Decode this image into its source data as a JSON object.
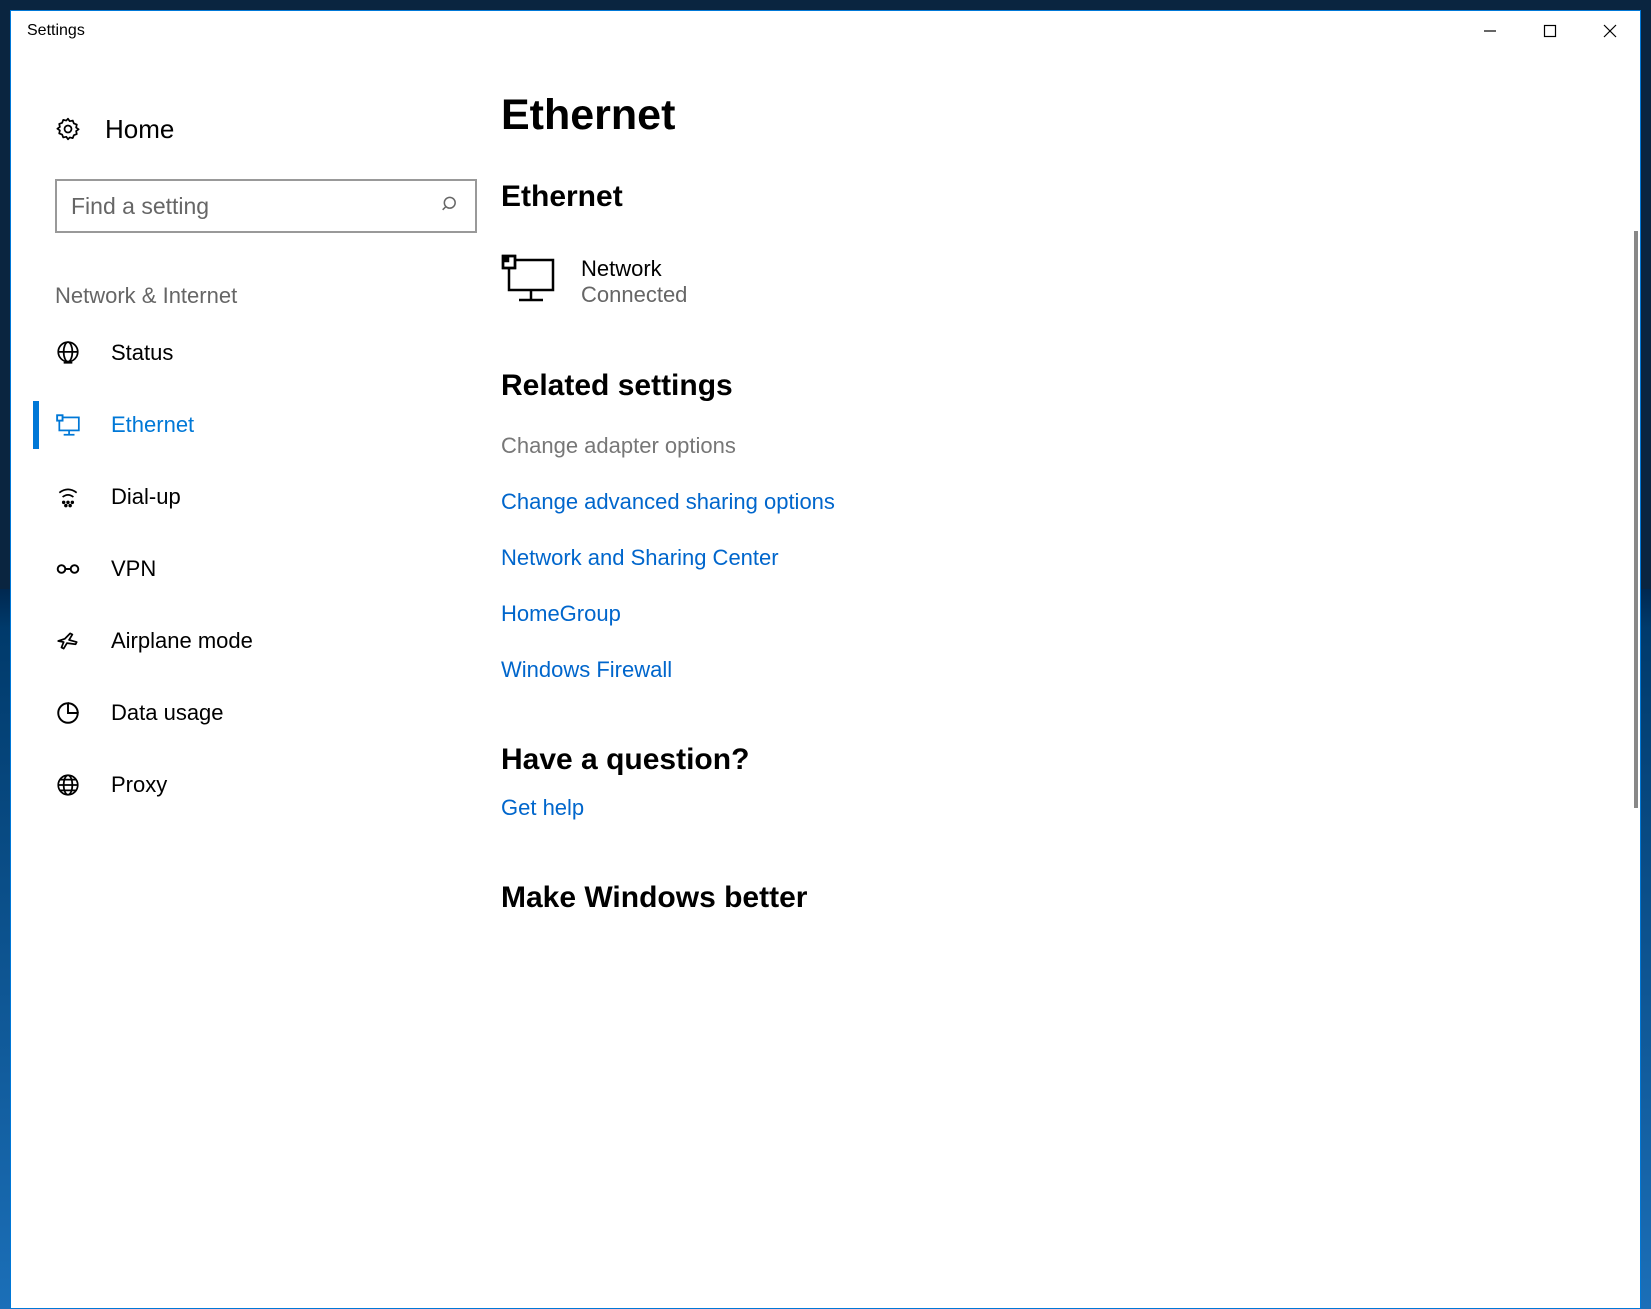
{
  "window": {
    "title": "Settings"
  },
  "sidebar": {
    "home_label": "Home",
    "search_placeholder": "Find a setting",
    "section_label": "Network & Internet",
    "items": [
      {
        "label": "Status"
      },
      {
        "label": "Ethernet"
      },
      {
        "label": "Dial-up"
      },
      {
        "label": "VPN"
      },
      {
        "label": "Airplane mode"
      },
      {
        "label": "Data usage"
      },
      {
        "label": "Proxy"
      }
    ]
  },
  "main": {
    "page_title": "Ethernet",
    "sub_heading": "Ethernet",
    "network": {
      "name": "Network",
      "status": "Connected"
    },
    "related_heading": "Related settings",
    "related_links": [
      "Change adapter options",
      "Change advanced sharing options",
      "Network and Sharing Center",
      "HomeGroup",
      "Windows Firewall"
    ],
    "question_heading": "Have a question?",
    "help_link": "Get help",
    "better_heading": "Make Windows better"
  }
}
